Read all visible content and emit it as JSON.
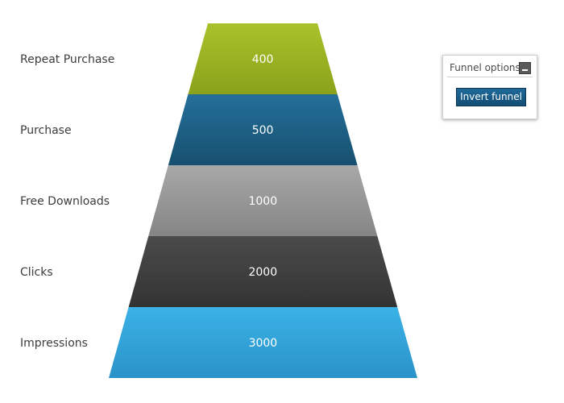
{
  "chart_data": {
    "type": "funnel",
    "categories": [
      "Repeat Purchase",
      "Purchase",
      "Free Downloads",
      "Clicks",
      "Impressions"
    ],
    "values": [
      400,
      500,
      1000,
      2000,
      3000
    ],
    "value_labels": [
      "400",
      "500",
      "1000",
      "2000",
      "3000"
    ],
    "colors": [
      [
        "#a9c22b",
        "#8aa21a"
      ],
      [
        "#246f9a",
        "#17506f"
      ],
      [
        "#a8a8a8",
        "#858585"
      ],
      [
        "#4b4b4b",
        "#333333"
      ],
      [
        "#3bb2e6",
        "#2a93c9"
      ]
    ],
    "legend": "none",
    "grid": false
  },
  "options_panel": {
    "title": "Funnel options",
    "invert_button_label": "Invert funnel"
  }
}
